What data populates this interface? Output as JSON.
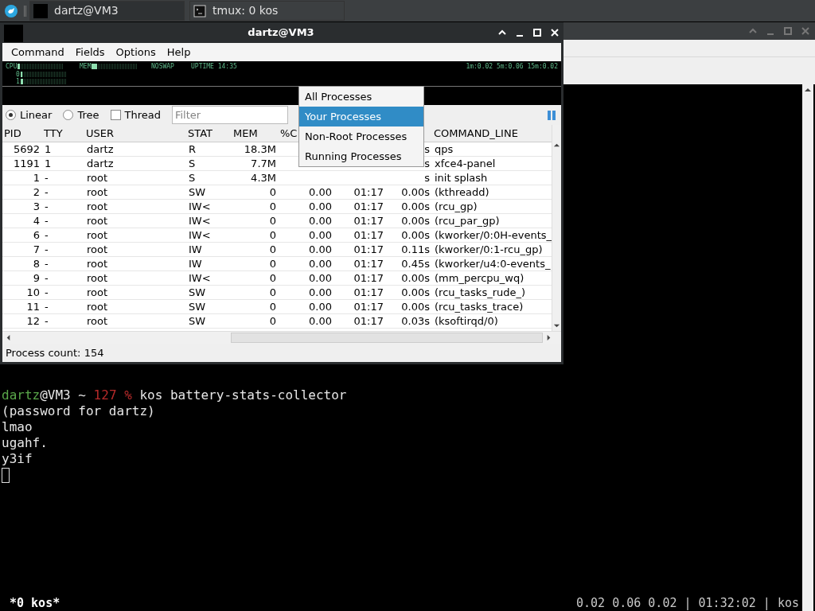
{
  "taskbar": {
    "tasks": [
      {
        "label": "dartz@VM3",
        "kind": "blank",
        "selected": true
      },
      {
        "label": "tmux: 0 kos",
        "kind": "terminal",
        "selected": false
      }
    ]
  },
  "terminal": {
    "lines": [
      {
        "user": "dartz",
        "host": "@VM3 ~ ",
        "code": "127 %",
        "command": " kos battery-stats-collector"
      },
      {
        "text": "(password for dartz)"
      },
      {
        "text": "lmao"
      },
      {
        "text": "ugahf."
      },
      {
        "text": "y3if"
      }
    ],
    "status_left": "*0 kos*",
    "status_right": "0.02 0.06 0.02 | 01:32:02 | kos"
  },
  "qps": {
    "title": "dartz@VM3",
    "menu": [
      "Command",
      "Fields",
      "Options",
      "Help"
    ],
    "meters": {
      "cpu": {
        "label": "CPU",
        "level": 0.05
      },
      "mem": {
        "label": "MEM",
        "level": 0.12
      },
      "swap": "NOSWAP",
      "uptime": "UPTIME 14:35",
      "cores": [
        {
          "label": "0",
          "level": 0.03
        },
        {
          "label": "1",
          "level": 0.05
        }
      ],
      "load": "1m:0.02 5m:0.06 15m:0.02"
    },
    "view": [
      {
        "label": "Linear",
        "kind": "radio",
        "checked": true
      },
      {
        "label": "Tree",
        "kind": "radio",
        "checked": false
      },
      {
        "label": "Thread",
        "kind": "checkbox",
        "checked": false
      }
    ],
    "filter": {
      "placeholder": "Filter"
    },
    "dropdown": [
      {
        "label": "All Processes",
        "selected": false
      },
      {
        "label": "Your Processes",
        "selected": true
      },
      {
        "label": "Non-Root Processes",
        "selected": false
      },
      {
        "label": "Running Processes",
        "selected": false
      }
    ],
    "table": {
      "columns": [
        "PID",
        "TTY",
        "USER",
        "STAT",
        "MEM",
        "%C",
        null,
        null,
        "COMMAND_LINE"
      ],
      "rows": [
        [
          "5692",
          "1",
          "dartz",
          "R",
          "18.3M",
          null,
          null,
          "s",
          "qps"
        ],
        [
          "1191",
          "1",
          "dartz",
          "S",
          "7.7M",
          null,
          null,
          "s",
          "xfce4-panel"
        ],
        [
          "1",
          "-",
          "root",
          "S",
          "4.3M",
          null,
          null,
          "s",
          "init splash"
        ],
        [
          "2",
          "-",
          "root",
          "SW",
          "0",
          "0.00",
          "01:17",
          "0.00s",
          "(kthreadd)"
        ],
        [
          "3",
          "-",
          "root",
          "IW<",
          "0",
          "0.00",
          "01:17",
          "0.00s",
          "(rcu_gp)"
        ],
        [
          "4",
          "-",
          "root",
          "IW<",
          "0",
          "0.00",
          "01:17",
          "0.00s",
          "(rcu_par_gp)"
        ],
        [
          "6",
          "-",
          "root",
          "IW<",
          "0",
          "0.00",
          "01:17",
          "0.00s",
          "(kworker/0:0H-events_"
        ],
        [
          "7",
          "-",
          "root",
          "IW",
          "0",
          "0.00",
          "01:17",
          "0.11s",
          "(kworker/0:1-rcu_gp)"
        ],
        [
          "8",
          "-",
          "root",
          "IW",
          "0",
          "0.00",
          "01:17",
          "0.45s",
          "(kworker/u4:0-events_"
        ],
        [
          "9",
          "-",
          "root",
          "IW<",
          "0",
          "0.00",
          "01:17",
          "0.00s",
          "(mm_percpu_wq)"
        ],
        [
          "10",
          "-",
          "root",
          "SW",
          "0",
          "0.00",
          "01:17",
          "0.00s",
          "(rcu_tasks_rude_)"
        ],
        [
          "11",
          "-",
          "root",
          "SW",
          "0",
          "0.00",
          "01:17",
          "0.00s",
          "(rcu_tasks_trace)"
        ],
        [
          "12",
          "-",
          "root",
          "SW",
          "0",
          "0.00",
          "01:17",
          "0.03s",
          "(ksoftirqd/0)"
        ]
      ]
    },
    "status": "Process count: 154"
  }
}
